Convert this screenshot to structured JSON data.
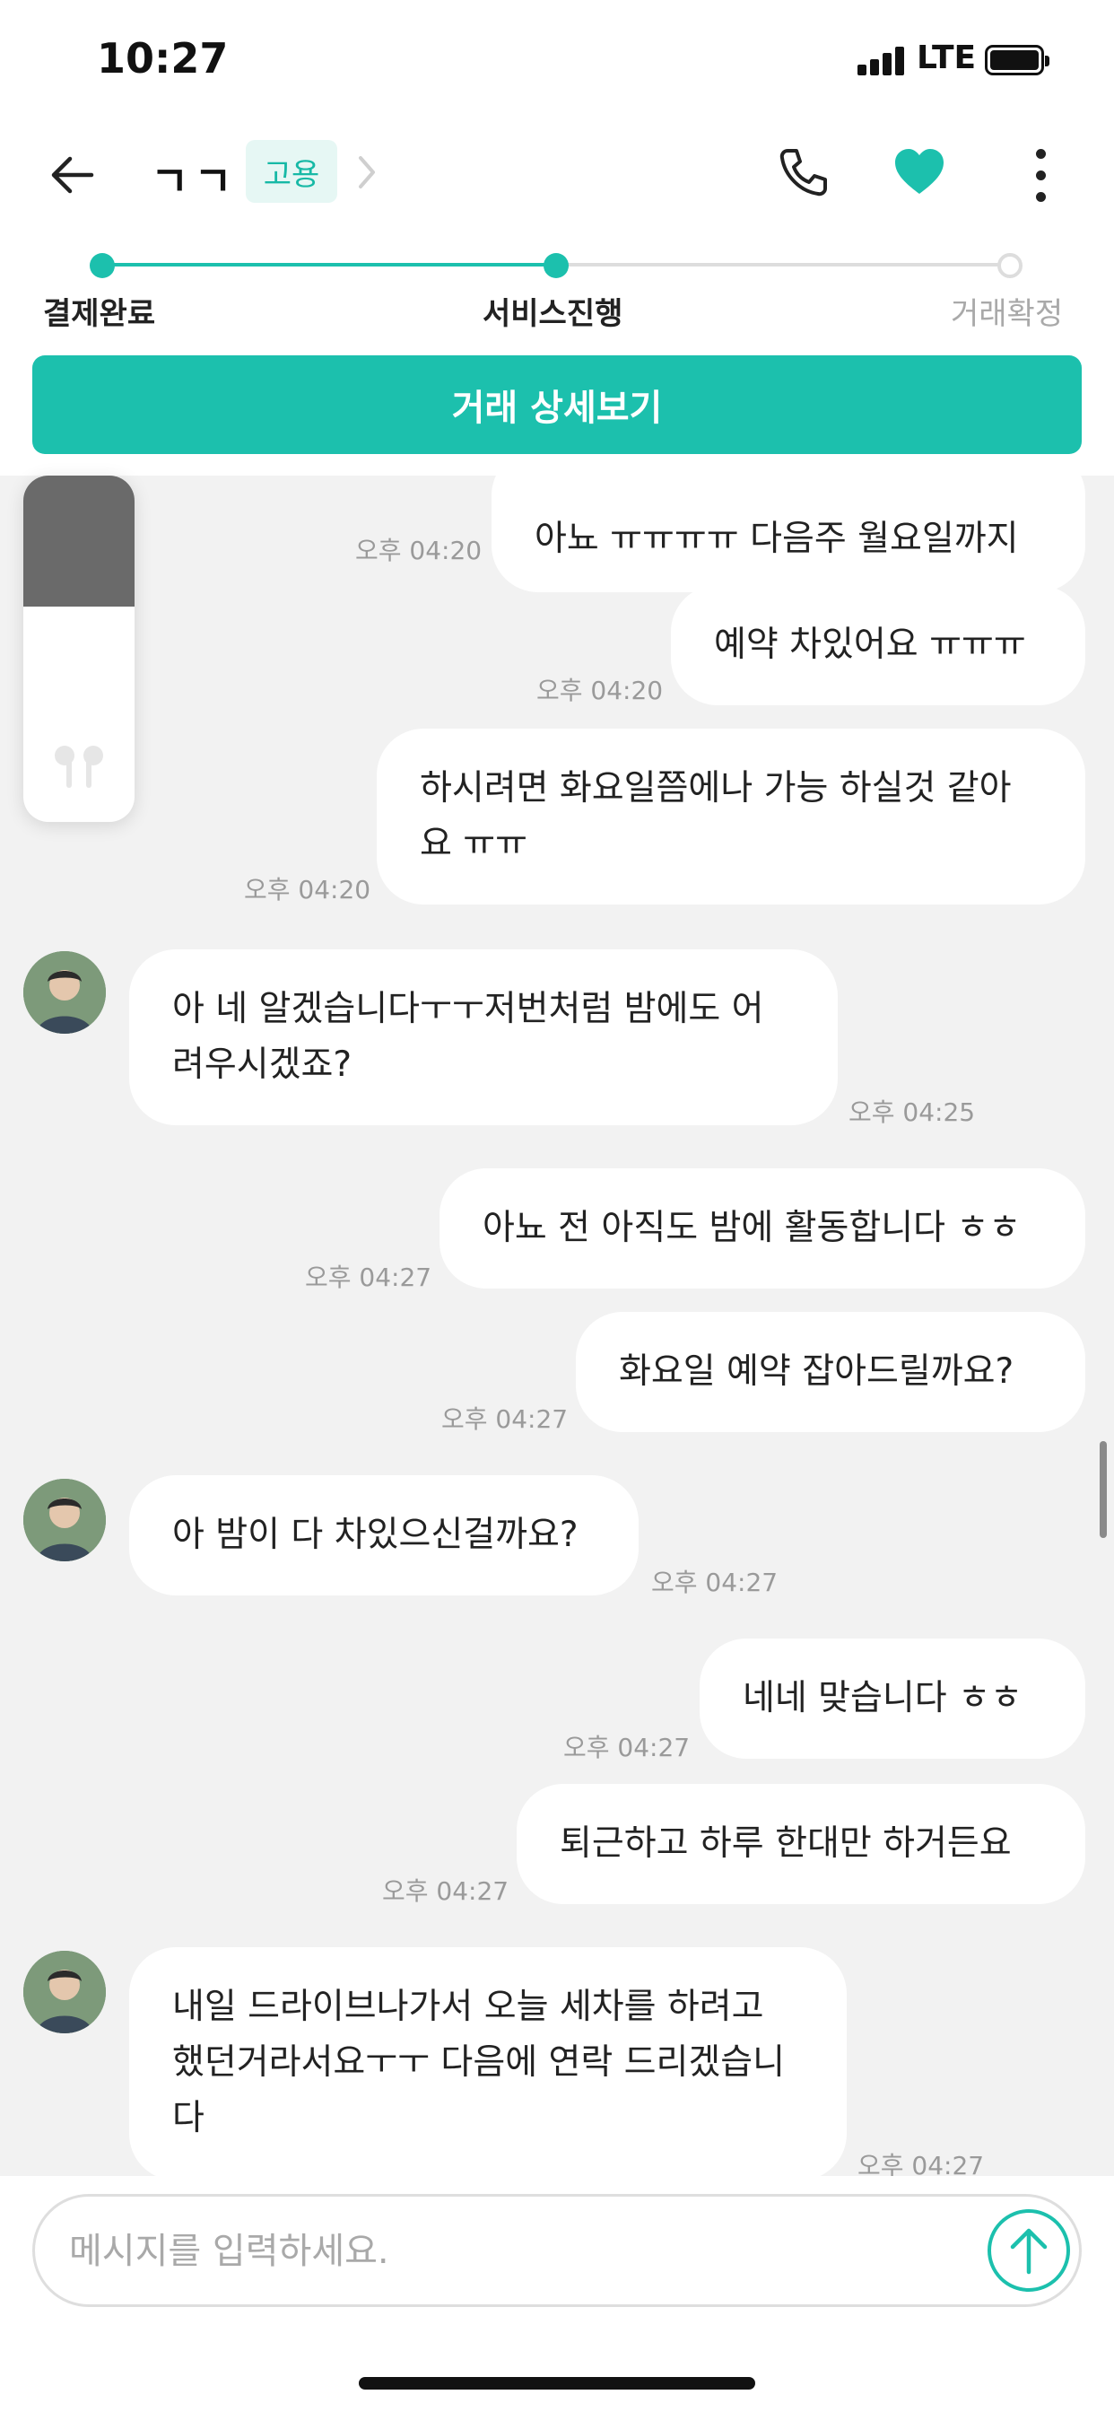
{
  "status_bar": {
    "time": "10:27",
    "network": "LTE"
  },
  "header": {
    "title": "ㄱㄱ",
    "badge": "고용"
  },
  "progress": {
    "steps": [
      {
        "label": "결제완료",
        "state": "done"
      },
      {
        "label": "서비스진행",
        "state": "current"
      },
      {
        "label": "거래확정",
        "state": "pending"
      }
    ]
  },
  "detail_button": "거래 상세보기",
  "messages": [
    {
      "side": "me",
      "text": "아뇨 ㅠㅠㅠㅠ 다음주 월요일까지",
      "time": "오후 04:20"
    },
    {
      "side": "me",
      "text": "예약 차있어요 ㅠㅠㅠ",
      "time": "오후 04:20"
    },
    {
      "side": "me",
      "text": "하시려면 화요일쯤에나 가능 하실것 같아요 ㅠㅠ",
      "time": "오후 04:20"
    },
    {
      "side": "them",
      "text": "아 네 알겠습니다ㅜㅜ저번처럼 밤에도 어려우시겠죠?",
      "time": "오후 04:25"
    },
    {
      "side": "me",
      "text": "아뇨 전 아직도 밤에 활동합니다 ㅎㅎ",
      "time": "오후 04:27"
    },
    {
      "side": "me",
      "text": "화요일 예약 잡아드릴까요?",
      "time": "오후 04:27"
    },
    {
      "side": "them",
      "text": "아 밤이 다 차있으신걸까요?",
      "time": "오후 04:27"
    },
    {
      "side": "me",
      "text": "네네 맞습니다 ㅎㅎ",
      "time": "오후 04:27"
    },
    {
      "side": "me",
      "text": "퇴근하고 하루 한대만 하거든요",
      "time": "오후 04:27"
    },
    {
      "side": "them",
      "text": "내일 드라이브나가서 오늘 세차를 하려고 했던거라서요ㅜㅜ 다음에 연락 드리겠습니다",
      "time": "오후 04:27"
    }
  ],
  "input": {
    "placeholder": "메시지를 입력하세요.",
    "value": ""
  },
  "colors": {
    "accent": "#1cc0ad",
    "background": "#f2f2f2",
    "bubble": "#ffffff"
  },
  "icons": [
    "back-arrow-icon",
    "chevron-right-icon",
    "phone-icon",
    "heart-icon",
    "more-icon",
    "send-arrow-icon",
    "earbuds-icon"
  ]
}
